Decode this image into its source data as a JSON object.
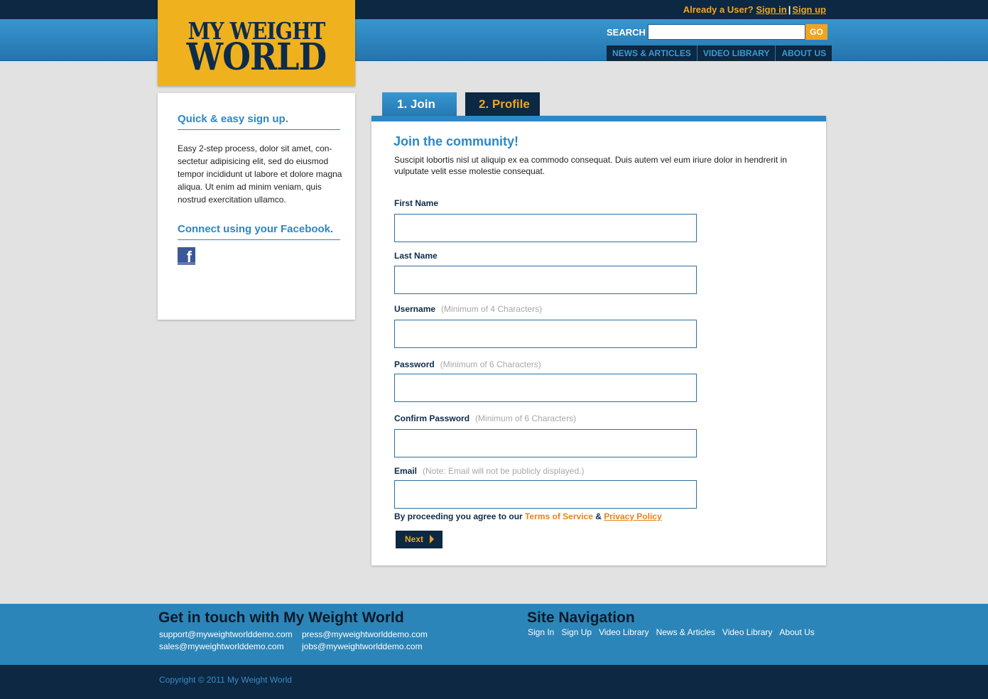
{
  "header": {
    "already_user": "Already a User?",
    "sign_in": "Sign in",
    "separator": "|",
    "sign_up": "Sign up",
    "search_label": "SEARCH",
    "search_value": "",
    "search_go": "GO",
    "nav": [
      "NEWS & ARTICLES",
      "VIDEO LIBRARY",
      "ABOUT US"
    ]
  },
  "logo": {
    "line1": "MY WEIGHT",
    "line2": "WORLD"
  },
  "sidebar": {
    "heading1": "Quick & easy sign up.",
    "text": "Easy 2-step process, dolor sit amet, con-sectetur adipisicing elit, sed do eiusmod tempor incididunt ut labore et dolore magna aliqua. Ut enim ad minim veniam, quis nostrud exercitation ullamco.",
    "heading2": "Connect using your Facebook.",
    "facebook_icon": "facebook-icon"
  },
  "tabs": [
    {
      "label": "1. Join",
      "active": true
    },
    {
      "label": "2. Profile",
      "active": false
    }
  ],
  "form": {
    "title": "Join the community!",
    "intro": "Suscipit lobortis nisl ut aliquip ex ea commodo consequat. Duis autem vel eum iriure dolor in hendrerit in vulputate velit esse molestie consequat.",
    "fields": [
      {
        "label": "First Name",
        "hint": "",
        "value": ""
      },
      {
        "label": "Last Name",
        "hint": "",
        "value": ""
      },
      {
        "label": "Username",
        "hint": "(Minimum of 4 Characters)",
        "value": ""
      },
      {
        "label": "Password",
        "hint": "(Minimum of 6 Characters)",
        "value": ""
      },
      {
        "label": "Confirm Password",
        "hint": "(Minimum of 6 Characters)",
        "value": ""
      },
      {
        "label": "Email",
        "hint": "(Note: Email will not be publicly displayed.)",
        "value": ""
      }
    ],
    "agree_prefix": "By proceeding you agree to our",
    "terms": "Terms of Service",
    "ampersand": "&",
    "privacy": "Privacy Policy",
    "next": "Next"
  },
  "footer": {
    "contact_heading": "Get in touch with My Weight World",
    "emails": [
      "support@myweightworlddemo.com",
      "press@myweightworlddemo.com",
      "sales@myweightworlddemo.com",
      "jobs@myweightworlddemo.com"
    ],
    "nav_heading": "Site Navigation",
    "nav_links": [
      "Sign In",
      "Sign Up",
      "Video Library",
      "News & Articles",
      "Video Library",
      "About Us"
    ],
    "copyright": "Copyright © 2011 My Weight World"
  },
  "colors": {
    "navy": "#0c2842",
    "blue": "#2c87c5",
    "orange": "#f0a421",
    "logo_yellow": "#f0b11f"
  }
}
